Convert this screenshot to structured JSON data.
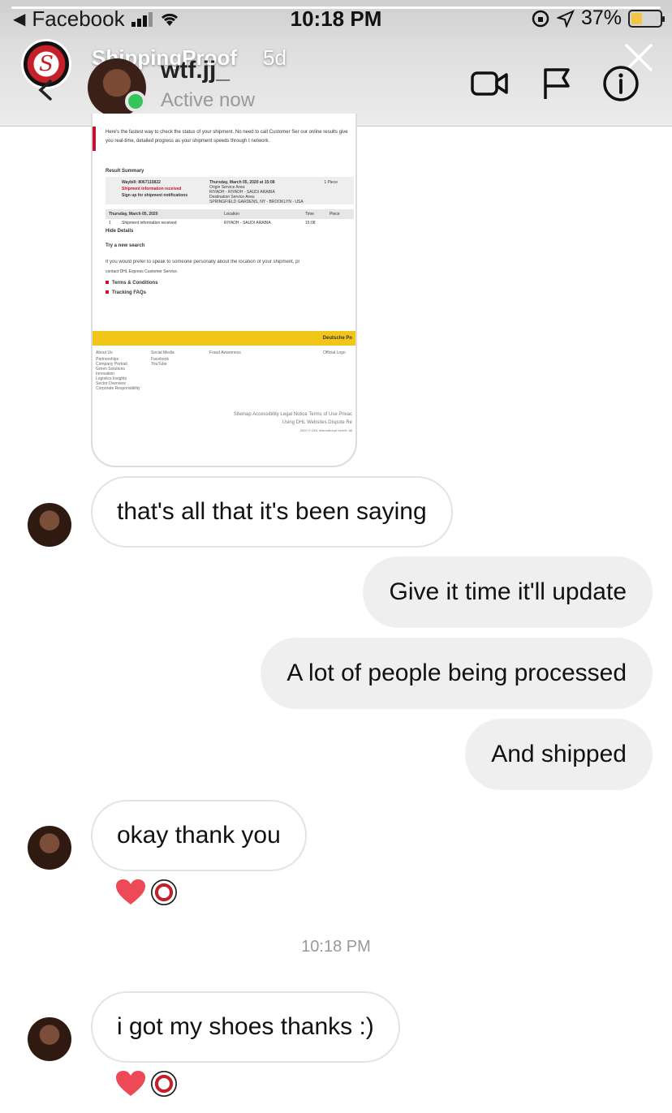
{
  "status_bar": {
    "back_app": "Facebook",
    "time": "10:18 PM",
    "battery": "37%",
    "battery_level": 0.37,
    "icons": [
      "signal-icon",
      "wifi-icon",
      "lock-rotation-icon",
      "location-icon",
      "battery-icon"
    ]
  },
  "story": {
    "account": "ShippingProof",
    "age": "5d",
    "progress": 1.0
  },
  "header": {
    "username": "wtf.jj_",
    "status": "Active now",
    "actions": [
      "video-call-icon",
      "flag-icon",
      "info-icon"
    ]
  },
  "screenshot": {
    "intro": "Here's the fastest way to check the status of your shipment. No need to call Customer Ser our online results give you real-time, detailed progress as your shipment speeds through t network.",
    "result_summary": "Result Summary",
    "waybill": "Waybill: 8067110822",
    "shipment_status": "Shipment information received",
    "signup": "Sign up for shipment notifications",
    "date_line": "Thursday, March 05, 2020 at 15:08",
    "origin_label": "Origin Service Area:",
    "origin": "RIYADH - RIYADH - SAUDI ARABIA",
    "destination_label": "Destination Service Area:",
    "destination": "SPRINGFIELD GARDENS, NY - BROOKLYN - USA",
    "pieces": "1 Piece",
    "table_headers": [
      "Thursday, March 05, 2020",
      "Location",
      "Time",
      "Piece"
    ],
    "table_row": [
      "1",
      "Shipment information received",
      "RIYADH - SAUDI ARABIA",
      "15:08"
    ],
    "hide_details": "Hide Details",
    "new_search": "Try a new search",
    "prefer_text": "If you would prefer to speak to someone personally about the location of your shipment, pl",
    "contact": "contact DHL Express Customer Service.",
    "links": [
      "Terms & Conditions",
      "Tracking FAQs"
    ],
    "banner": "Deutsche Po",
    "footer_cols": [
      [
        "About Us",
        "Partnerships",
        "Company Portrait",
        "Green Solutions",
        "Innovation",
        "Logistics Insights",
        "Sector Overview",
        "Corporate Responsibility"
      ],
      [
        "Social Media",
        "Facebook",
        "YouTube"
      ],
      [
        "Fraud Awareness"
      ],
      [
        "Official Logo"
      ]
    ],
    "bottom_links": "Sitemap Accessibility Legal Notice Terms of Use Privac",
    "bottom_links2": "Using DHL Websites Dispute Re",
    "copyright": "2020 © DHL International GmbH. All"
  },
  "messages": [
    {
      "side": "in",
      "text": "that's all that it's been saying"
    },
    {
      "side": "out",
      "text": "Give it time it'll update"
    },
    {
      "side": "out",
      "text": "A lot of people being processed"
    },
    {
      "side": "out",
      "text": "And shipped"
    },
    {
      "side": "in",
      "text": "okay thank you"
    },
    {
      "side": "in",
      "text": "i got my shoes thanks :)"
    }
  ],
  "timestamp": "10:18 PM",
  "colors": {
    "online": "#35c35a",
    "heart": "#ed4956",
    "bubble_out": "#efefef",
    "dhl_yellow": "#f2c618",
    "dhl_red": "#c8102e"
  }
}
